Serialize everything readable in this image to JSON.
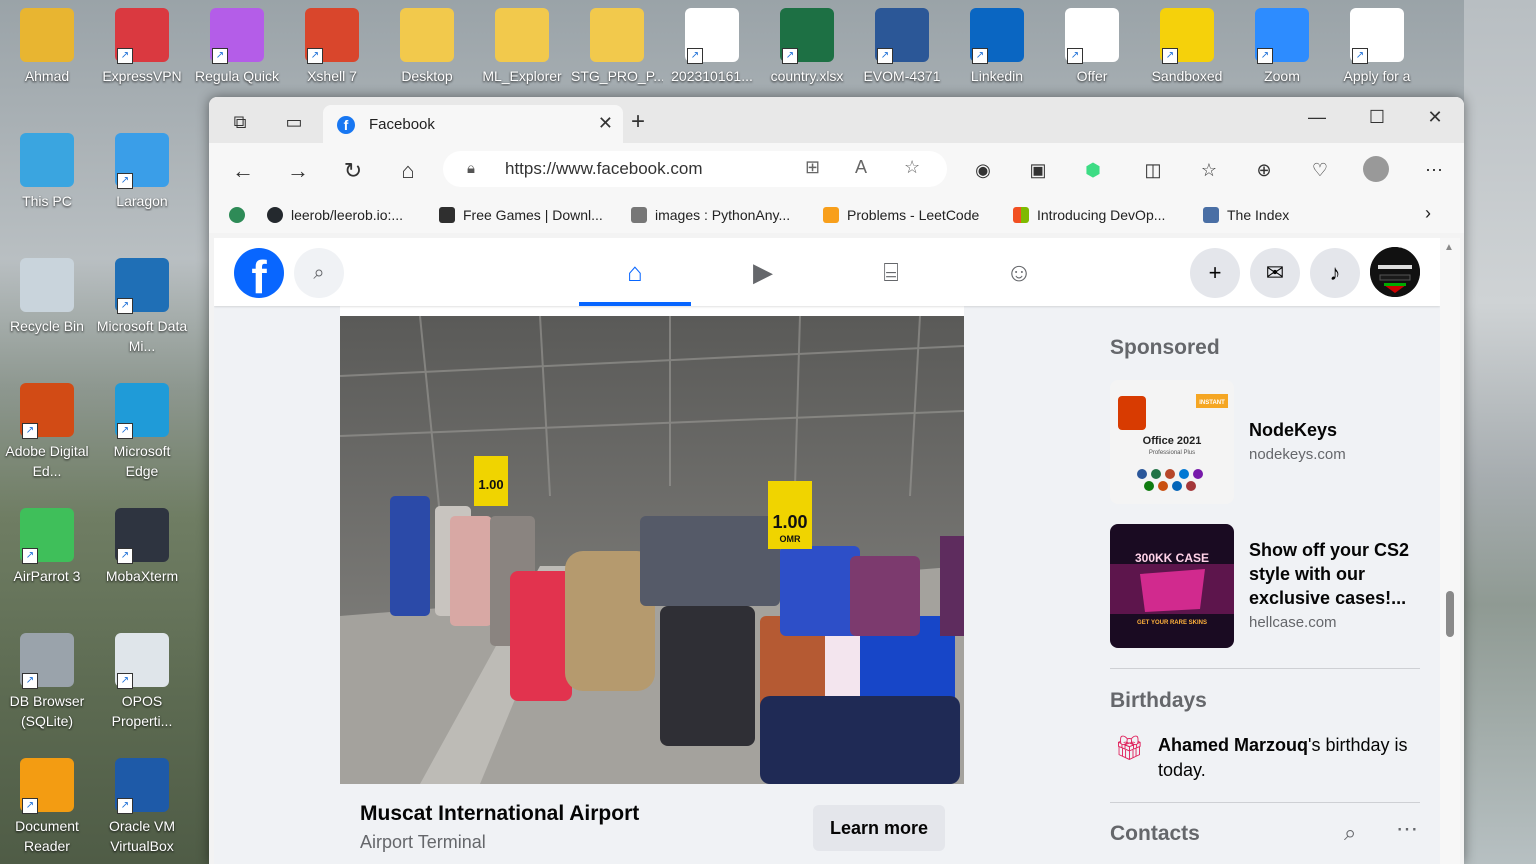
{
  "desktop": {
    "icons": [
      {
        "label": "Ahmad",
        "color": "#e8b531"
      },
      {
        "label": "ExpressVPN",
        "color": "#da3940"
      },
      {
        "label": "Regula Quick",
        "color": "#b45de8"
      },
      {
        "label": "Xshell 7",
        "color": "#d9462c"
      },
      {
        "label": "Desktop",
        "color": "#f2c94c"
      },
      {
        "label": "ML_Explorer",
        "color": "#f2c94c"
      },
      {
        "label": "STG_PRO_P...",
        "color": "#f2c94c"
      },
      {
        "label": "202310161...",
        "color": "#ffffff"
      },
      {
        "label": "country.xlsx",
        "color": "#1d7044"
      },
      {
        "label": "EVOM-4371",
        "color": "#2b5797"
      },
      {
        "label": "Linkedin",
        "color": "#0a66c2"
      },
      {
        "label": "Offer",
        "color": "#ffffff"
      },
      {
        "label": "Sandboxed",
        "color": "#f5d10b"
      },
      {
        "label": "Zoom",
        "color": "#2d8cff"
      },
      {
        "label": "Apply for a",
        "color": "#ffffff"
      },
      {
        "label": "This PC",
        "color": "#3aa5e0"
      },
      {
        "label": "Laragon",
        "color": "#3a9ee8"
      },
      {
        "label": "Recycle Bin",
        "color": "#c9d4dc"
      },
      {
        "label": "Microsoft Data Mi...",
        "color": "#1f6fb6"
      },
      {
        "label": "Adobe Digital Ed...",
        "color": "#d24b15"
      },
      {
        "label": "Microsoft Edge",
        "color": "#1f9bd8"
      },
      {
        "label": "AirParrot 3",
        "color": "#3fbf5a"
      },
      {
        "label": "MobaXterm",
        "color": "#2e3440"
      },
      {
        "label": "DB Browser (SQLite)",
        "color": "#9aa3ab"
      },
      {
        "label": "OPOS Properti...",
        "color": "#dfe5ea"
      },
      {
        "label": "Document Reader",
        "color": "#f39c12"
      },
      {
        "label": "Oracle VM VirtualBox",
        "color": "#1e5aa8"
      }
    ]
  },
  "browser": {
    "tab_title": "Facebook",
    "url": "https://www.facebook.com",
    "bookmarks": [
      {
        "label": "leerob/leerob.io:...",
        "color": "#24292e"
      },
      {
        "label": "Free Games | Downl...",
        "color": "#2f2f2f"
      },
      {
        "label": "images : PythonAny...",
        "color": "#555555"
      },
      {
        "label": "Problems - LeetCode",
        "color": "#f89f1b"
      },
      {
        "label": "Introducing DevOp...",
        "color": "#f25022"
      },
      {
        "label": "The Index",
        "color": "#4a6fa5"
      }
    ]
  },
  "facebook": {
    "post": {
      "cta_title": "Muscat International Airport",
      "cta_subtitle": "Airport Terminal",
      "cta_button": "Learn more",
      "sign_price": "1.00",
      "sign_unit": "OMR"
    },
    "sponsored_title": "Sponsored",
    "ads": [
      {
        "name": "NodeKeys",
        "domain": "nodekeys.com",
        "thumb_text": "Office 2021",
        "thumb_sub": "Professional Plus",
        "thumb_badge": "INSTANT"
      },
      {
        "name": "Show off your CS2 style with our exclusive cases!...",
        "domain": "hellcase.com",
        "thumb_text": "300KK CASE",
        "thumb_sub": "GET YOUR RARE SKINS"
      }
    ],
    "birthdays_title": "Birthdays",
    "birthday_name": "Ahamed Marzouq",
    "birthday_rest": "'s birthday is today.",
    "contacts_title": "Contacts"
  }
}
